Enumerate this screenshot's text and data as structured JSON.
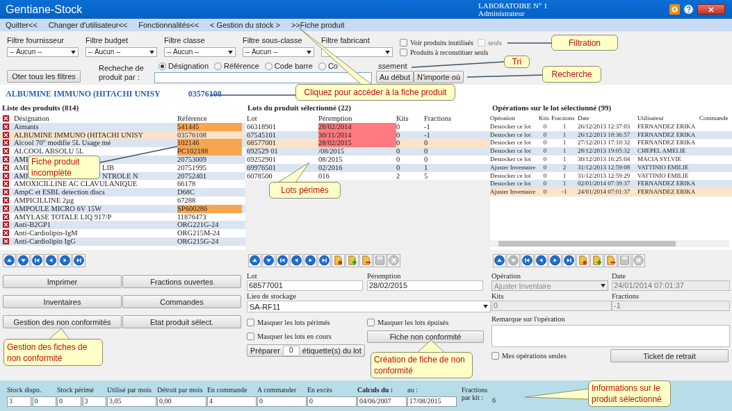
{
  "window": {
    "title": "Gentiane-Stock",
    "lab": "LABORATOIRE N° 1",
    "role": "Administrateur"
  },
  "menu": [
    {
      "label": "Quitter<<"
    },
    {
      "label": "Changer d'utilisateur<<"
    },
    {
      "label": "Fonctionnalités<<"
    },
    {
      "label": "< Gestion du stock >"
    },
    {
      "label": ">>Fiche produit"
    }
  ],
  "filters": [
    {
      "label": "Filtre fournisseur",
      "value": "-- Aucun --"
    },
    {
      "label": "Filtre budget",
      "value": "-- Aucun --"
    },
    {
      "label": "Filtre classe",
      "value": "-- Aucun --"
    },
    {
      "label": "Filtre sous-classe",
      "value": "-- Aucun --"
    },
    {
      "label": "Filtre fabricant"
    }
  ],
  "options": [
    {
      "label": "Voir produits inutilisés",
      "checked": false,
      "disabled": false
    },
    {
      "label": "seuls",
      "checked": false,
      "disabled": true
    },
    {
      "label": "Produits à reconstituer seuls",
      "checked": false,
      "disabled": false
    }
  ],
  "clear_filters_button": "Oter tous les filtres",
  "search": {
    "label": "Recheche de produit par :",
    "modes": [
      {
        "label": "Désignation",
        "selected": true
      },
      {
        "label": "Référence",
        "selected": false
      },
      {
        "label": "Code barre",
        "selected": false
      },
      {
        "label": "Co",
        "label_tail": "ssement",
        "selected": false
      }
    ],
    "buttons": [
      "Au début",
      "N'importe où"
    ]
  },
  "selected_product": {
    "name": "ALBUMINE IMMUNO (HITACHI UNISY",
    "reference": "03576108"
  },
  "products": {
    "title": "Liste des produits (814)",
    "columns": [
      "Désignation",
      "Référence"
    ],
    "rows": [
      {
        "designation": "Aimants",
        "reference": "541445",
        "incomplete": true,
        "selected": false
      },
      {
        "designation": "ALBUMINE IMMUNO (HITACHI UNISY",
        "reference": "03576108",
        "incomplete": false,
        "selected": true
      },
      {
        "designation": "Alcool 70° modifie 5L Usage mé",
        "reference": "102146",
        "incomplete": true,
        "selected": false
      },
      {
        "designation": "ALCOOL ABSOLU 5L",
        "reference": "PC102188",
        "incomplete": true,
        "selected": false
      },
      {
        "designation": "AMI",
        "reference": "20753009",
        "incomplete": false,
        "selected": false
      },
      {
        "designation": "AMI",
        "designation_tail": "LIB",
        "reference": "20751995",
        "incomplete": false,
        "selected": false
      },
      {
        "designation": "AMI",
        "designation_tail": "NTROLE N",
        "reference": "20752401",
        "incomplete": false,
        "selected": false
      },
      {
        "designation": "AMOXICILLINE AC CLAVULANIQUE",
        "reference": "66178",
        "incomplete": false,
        "selected": false
      },
      {
        "designation": "AmpC et ESBL detection discs",
        "reference": "D68C",
        "incomplete": false,
        "selected": false
      },
      {
        "designation": "AMPICILLINE 2µg",
        "reference": "67288",
        "incomplete": false,
        "selected": false
      },
      {
        "designation": "AMPOULE MICRO 6V 15W",
        "reference": "SP600286",
        "incomplete": true,
        "selected": false
      },
      {
        "designation": "AMYLASE TOTALE LIQ 917/P",
        "reference": "11876473",
        "incomplete": false,
        "selected": false
      },
      {
        "designation": "Anti-B2GP1",
        "reference": "ORG221G-24",
        "incomplete": false,
        "selected": false
      },
      {
        "designation": "Anti-Cardiolipin-IgM",
        "reference": "ORG215M-24",
        "incomplete": false,
        "selected": false
      },
      {
        "designation": "Anti-Cardiolipin IgG",
        "reference": "ORG215G-24",
        "incomplete": false,
        "selected": false
      }
    ]
  },
  "lots": {
    "title": "Lots du produit sélectionné (22)",
    "columns": [
      "Lot",
      "Péremption",
      "Kits",
      "Fractions"
    ],
    "rows": [
      {
        "lot": "66318901",
        "expiry": "28/02/2014",
        "kits": "0",
        "fractions": "-1",
        "expired": true,
        "selected": false
      },
      {
        "lot": "67545101",
        "expiry": "30/11/2014",
        "kits": "0",
        "fractions": "-1",
        "expired": true,
        "selected": false
      },
      {
        "lot": "68577001",
        "expiry": "28/02/2015",
        "kits": "0",
        "fractions": "0",
        "expired": true,
        "selected": true
      },
      {
        "lot": "692529 01",
        "expiry": "/08/2015",
        "kits": "0",
        "fractions": "0",
        "expired": false,
        "selected": false
      },
      {
        "lot": "69252901",
        "expiry": "08/2015",
        "kits": "0",
        "fractions": "0",
        "expired": false,
        "selected": false
      },
      {
        "lot": "69976501",
        "expiry": "02/2016",
        "kits": "0",
        "fractions": "1",
        "expired": false,
        "selected": false
      },
      {
        "lot": "6078500",
        "expiry": "016",
        "kits": "2",
        "fractions": "5",
        "expired": false,
        "selected": false
      }
    ]
  },
  "operations": {
    "title": "Opérations sur le lot sélectionné (99)",
    "columns": [
      "Opération",
      "Kits",
      "Fractions",
      "Date",
      "Utilisateur",
      "Commande"
    ],
    "rows": [
      {
        "operation": "Destocker ce lot",
        "kits": "0",
        "fractions": "1",
        "date": "26/12/2013 12:37:03",
        "user": "FERNANDEZ ERIKA",
        "selected": false
      },
      {
        "operation": "Destocker ce lot",
        "kits": "0",
        "fractions": "1",
        "date": "26/12/2013 18:36:57",
        "user": "FERNANDEZ ERIKA",
        "selected": false
      },
      {
        "operation": "Destocker ce lot",
        "kits": "0",
        "fractions": "1",
        "date": "27/12/2013 17:10:32",
        "user": "FERNANDEZ ERIKA",
        "selected": false
      },
      {
        "operation": "Destocker ce lot",
        "kits": "0",
        "fractions": "1",
        "date": "28/12/2013 19:05:32",
        "user": "CHEPEL AMELIE",
        "selected": false
      },
      {
        "operation": "Destocker ce lot",
        "kits": "0",
        "fractions": "1",
        "date": "30/12/2013 16:25:04",
        "user": "MACIA SYLVIE",
        "selected": false
      },
      {
        "operation": "Ajuster Inventaire",
        "kits": "0",
        "fractions": "2",
        "date": "31/12/2013 12:59:08",
        "user": "VATTINIO EMILIE",
        "selected": false
      },
      {
        "operation": "Destocker ce lot",
        "kits": "0",
        "fractions": "1",
        "date": "31/12/2013 12:59:29",
        "user": "VATTINIO EMILIE",
        "selected": false
      },
      {
        "operation": "Destocker ce lot",
        "kits": "0",
        "fractions": "1",
        "date": "02/01/2014 07:39:37",
        "user": "FERNANDEZ ERIKA",
        "selected": false
      },
      {
        "operation": "Ajuster Inventaire",
        "kits": "0",
        "fractions": "-1",
        "date": "24/01/2014 07:01:37",
        "user": "FERNANDEZ ERIKA",
        "selected": true
      }
    ]
  },
  "toolbars": [
    {
      "buttons": [
        {
          "kind": "up",
          "disabled": false
        },
        {
          "kind": "down",
          "disabled": false
        },
        {
          "kind": "first",
          "disabled": false
        },
        {
          "kind": "prev",
          "disabled": false
        },
        {
          "kind": "next",
          "disabled": false
        },
        {
          "kind": "last",
          "disabled": false
        }
      ]
    },
    {
      "buttons": [
        {
          "kind": "up",
          "disabled": false
        },
        {
          "kind": "down",
          "disabled": false
        },
        {
          "kind": "first",
          "disabled": false
        },
        {
          "kind": "prev",
          "disabled": false
        },
        {
          "kind": "next",
          "disabled": false
        },
        {
          "kind": "last",
          "disabled": false
        },
        {
          "kind": "flag",
          "disabled": false
        },
        {
          "kind": "add",
          "disabled": false
        },
        {
          "kind": "remove",
          "disabled": false
        },
        {
          "kind": "save",
          "disabled": true
        },
        {
          "kind": "cancel",
          "disabled": true
        }
      ]
    },
    {
      "buttons": [
        {
          "kind": "up",
          "disabled": false
        },
        {
          "kind": "down",
          "disabled": true
        },
        {
          "kind": "first",
          "disabled": false
        },
        {
          "kind": "prev",
          "disabled": false
        },
        {
          "kind": "next",
          "disabled": false
        },
        {
          "kind": "last",
          "disabled": false
        },
        {
          "kind": "flag",
          "disabled": false
        },
        {
          "kind": "add",
          "disabled": false
        },
        {
          "kind": "remove",
          "disabled": false
        },
        {
          "kind": "save",
          "disabled": true
        },
        {
          "kind": "cancel",
          "disabled": true
        }
      ]
    }
  ],
  "actions": [
    "Imprimer",
    "Fractions ouvertes",
    "Inventaires",
    "Commandes",
    "Gestion des non conformités",
    "Etat produit sélect."
  ],
  "lot_form": {
    "lot_label": "Lot",
    "lot": "68577001",
    "expiry_label": "Péremption",
    "expiry": "28/02/2015",
    "storage_label": "Lieu de stockage",
    "storage": "SA-RF11",
    "options": [
      {
        "label": "Masquer les lots périmés",
        "checked": false
      },
      {
        "label": "Masquer les lots épuisés",
        "checked": false
      },
      {
        "label": "Masquer les lots en cours",
        "checked": false
      }
    ],
    "prepare_label": "Préparer",
    "prepare_count": "0",
    "prepare_suffix": "étiquette(s) du lot",
    "nonconformity_button": "Fiche non conformité"
  },
  "operation_form": {
    "disabled": true,
    "operation_label": "Opération",
    "operation": "Ajuster Inventaire",
    "date_label": "Date",
    "date": "24/01/2014 07:01:37",
    "kits_label": "Kits",
    "kits": "0",
    "fractions_label": "Fractions",
    "fractions": "-1",
    "remark_label": "Remarque sur l'opération",
    "own_only": {
      "label": "Mes opérations seules",
      "checked": false
    },
    "ticket_button": "Ticket de retrait"
  },
  "status_bar": {
    "fields": [
      {
        "label": "Stock dispo.",
        "values": [
          "3",
          "0"
        ],
        "bold": false
      },
      {
        "label": "Stock périmé",
        "values": [
          "0",
          "3"
        ],
        "bold": false
      },
      {
        "label": "Utilisé par mois",
        "values": [
          "3,05"
        ],
        "bold": false
      },
      {
        "label": "Détruit par mois",
        "values": [
          "0,00"
        ],
        "bold": false
      },
      {
        "label": "En commande",
        "values": [
          "4"
        ],
        "bold": false
      },
      {
        "label": "A commander",
        "values": [
          "0"
        ],
        "bold": false
      },
      {
        "label": "En excès",
        "values": [
          "0"
        ],
        "bold": false
      },
      {
        "label": "Calculs du :",
        "values": [
          "04/06/2007"
        ],
        "bold": true
      },
      {
        "label": "au :",
        "values": [
          "17/08/2015"
        ],
        "bold": false
      }
    ],
    "fractions_label": "Fractions par kit :",
    "fractions_per_kit": "6"
  },
  "callouts": [
    "Filtration",
    "Tri",
    "Recherche",
    "Cliquez pour accéder à la fiche produit",
    "Fiche produit incomplète",
    "Lots périmés",
    "Gestion des fiches de non conformité",
    "Création de fiche de non conformité",
    "Informations sur le produit sélectionné"
  ]
}
